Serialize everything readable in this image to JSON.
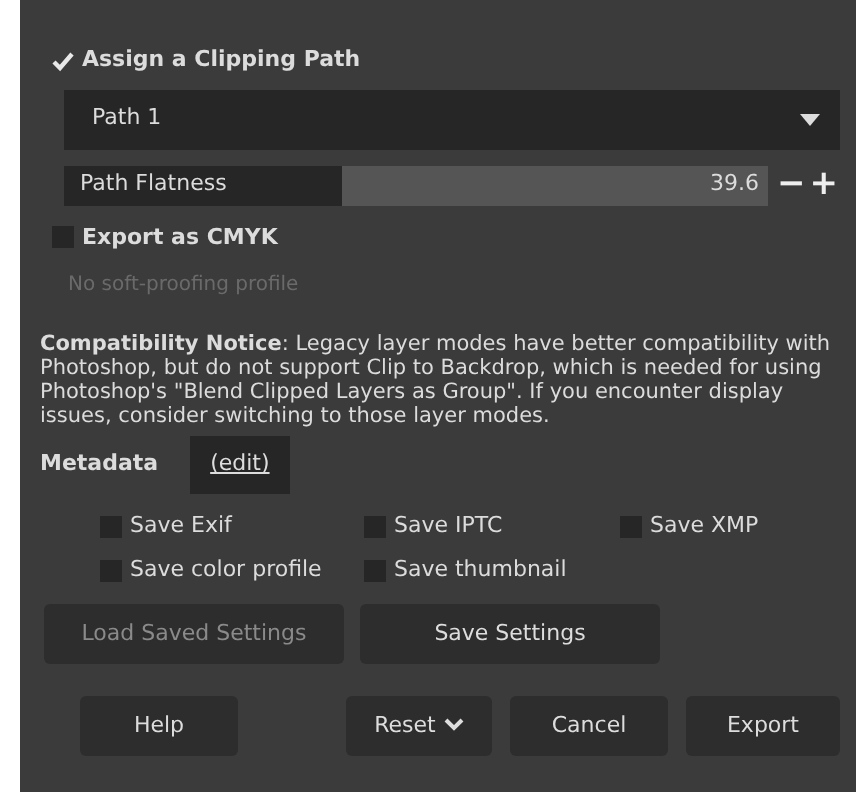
{
  "clipping_path": {
    "label": "Assign a Clipping Path",
    "checked": true
  },
  "path_dropdown": {
    "value": "Path 1"
  },
  "path_flatness": {
    "label": "Path Flatness",
    "reading": "39.6",
    "level": 0.396,
    "minus": "−",
    "plus": "+"
  },
  "export_cmyk": {
    "label": "Export as CMYK",
    "checked": false
  },
  "soft_proof": {
    "text": "No soft-proofing profile",
    "disabled": true
  },
  "notice": "**Compatibility Notice**: Legacy layer modes have better compatibility with Photoshop, but do not support Clip to Backdrop, which is needed for using Photoshop's \"Blend Clipped Layers as Group\". If you encounter display issues, consider switching to those layer modes.",
  "metadata": {
    "label": "Metadata",
    "edit": "(edit)"
  },
  "metadata_options": [
    {
      "label": "Save Exif",
      "checked": false
    },
    {
      "label": "Save IPTC",
      "checked": false
    },
    {
      "label": "Save XMP",
      "checked": false
    },
    {
      "label": "Save color profile",
      "checked": false
    },
    {
      "label": "Save thumbnail",
      "checked": false
    }
  ],
  "settings_buttons": [
    {
      "label": "Load Saved Settings",
      "disabled": true
    },
    {
      "label": "Save Settings",
      "disabled": false
    }
  ],
  "buttons": [
    {
      "label": "Help",
      "kind": "plain"
    },
    {
      "label": "Reset",
      "kind": "dropdown"
    },
    {
      "label": "Cancel",
      "kind": "plain"
    },
    {
      "label": "Export",
      "kind": "plain"
    }
  ]
}
